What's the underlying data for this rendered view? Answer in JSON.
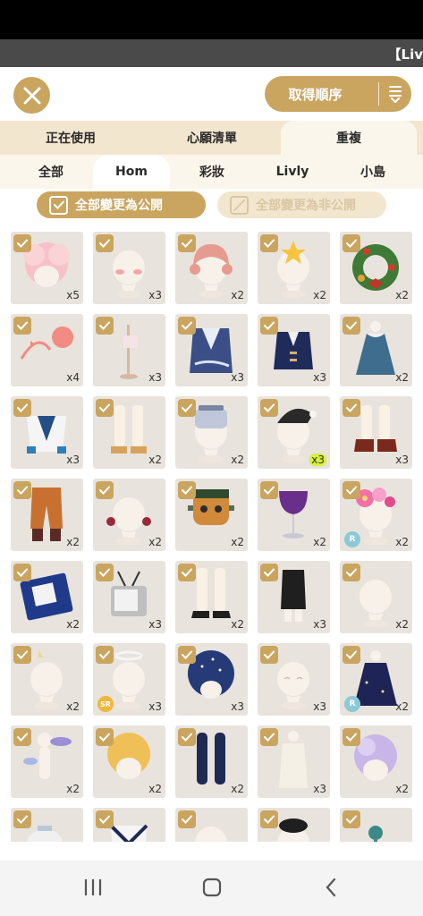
{
  "banner": {
    "text": "【Liv"
  },
  "header": {
    "sort_label": "取得順序"
  },
  "tabs_primary": [
    {
      "label": "正在使用",
      "active": false
    },
    {
      "label": "心願清單",
      "active": false
    },
    {
      "label": "重複",
      "active": true
    }
  ],
  "tabs_secondary": [
    {
      "label": "全部",
      "active": false
    },
    {
      "label": "Hom",
      "active": true
    },
    {
      "label": "彩妝",
      "active": false
    },
    {
      "label": "Livly",
      "active": false
    },
    {
      "label": "小島",
      "active": false
    }
  ],
  "actions": {
    "make_all_public": "全部變更為公開",
    "make_all_private": "全部變更為非公開"
  },
  "colors": {
    "accent": "#c9a560",
    "tab_bar": "#f2e6cf",
    "cell_bg": "#e8e3dc"
  },
  "items": [
    {
      "icon": "pink-fluffy-hair-icon",
      "count": "x5"
    },
    {
      "icon": "blush-face-icon",
      "count": "x3"
    },
    {
      "icon": "pink-bob-hair-icon",
      "count": "x2"
    },
    {
      "icon": "star-hairpin-icon",
      "count": "x2"
    },
    {
      "icon": "christmas-wreath-icon",
      "count": "x2"
    },
    {
      "icon": "pink-ribbon-ball-icon",
      "count": "x4"
    },
    {
      "icon": "standing-ornament-icon",
      "count": "x3"
    },
    {
      "icon": "blue-pattern-coat-icon",
      "count": "x3"
    },
    {
      "icon": "navy-jacket-icon",
      "count": "x3"
    },
    {
      "icon": "blue-dress-icon",
      "count": "x2"
    },
    {
      "icon": "blue-white-top-icon",
      "count": "x3"
    },
    {
      "icon": "white-socks-sandals-icon",
      "count": "x2"
    },
    {
      "icon": "glass-jar-hat-icon",
      "count": "x2"
    },
    {
      "icon": "black-nightcap-icon",
      "count": "x3",
      "highlight": true
    },
    {
      "icon": "brown-boots-icon",
      "count": "x3"
    },
    {
      "icon": "orange-pants-icon",
      "count": "x2"
    },
    {
      "icon": "earrings-face-icon",
      "count": "x2"
    },
    {
      "icon": "frankenstein-mask-icon",
      "count": "x2"
    },
    {
      "icon": "purple-cocktail-glass-icon",
      "count": "x2"
    },
    {
      "icon": "pink-flower-crown-icon",
      "count": "x2",
      "rarity": "R"
    },
    {
      "icon": "blue-book-icon",
      "count": "x2"
    },
    {
      "icon": "retro-tv-icon",
      "count": "x3"
    },
    {
      "icon": "white-socks-shoes-icon",
      "count": "x2"
    },
    {
      "icon": "black-skirt-icon",
      "count": "x3"
    },
    {
      "icon": "plain-face-icon",
      "count": "x2"
    },
    {
      "icon": "small-horns-icon",
      "count": "x2"
    },
    {
      "icon": "halo-icon",
      "count": "x3",
      "rarity": "SR"
    },
    {
      "icon": "starry-hair-icon",
      "count": "x3"
    },
    {
      "icon": "smile-face-icon",
      "count": "x3"
    },
    {
      "icon": "starry-robe-icon",
      "count": "x2",
      "rarity": "R"
    },
    {
      "icon": "cloud-wings-icon",
      "count": "x2"
    },
    {
      "icon": "blonde-hair-icon",
      "count": "x2"
    },
    {
      "icon": "navy-tights-icon",
      "count": "x2"
    },
    {
      "icon": "white-robe-icon",
      "count": "x3"
    },
    {
      "icon": "lavender-hair-icon",
      "count": "x2"
    },
    {
      "icon": "teapot-icon",
      "count": ""
    },
    {
      "icon": "sailor-collar-icon",
      "count": ""
    },
    {
      "icon": "plain-bust-icon",
      "count": ""
    },
    {
      "icon": "black-beret-icon",
      "count": ""
    },
    {
      "icon": "teal-ornament-icon",
      "count": ""
    }
  ]
}
